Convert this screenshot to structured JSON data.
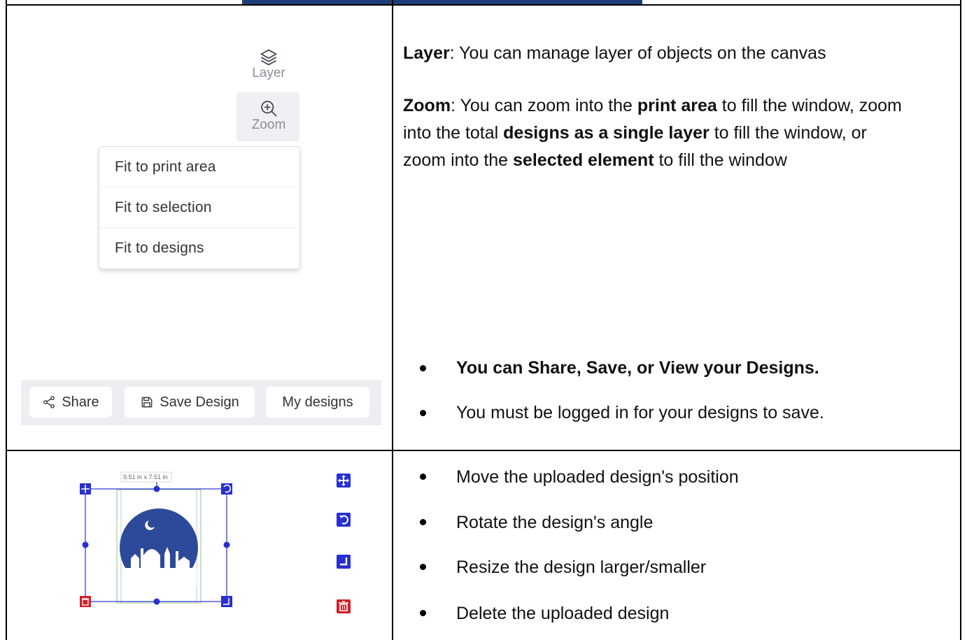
{
  "toolbar": {
    "layer_label": "Layer",
    "zoom_label": "Zoom"
  },
  "zoom_menu": {
    "items": [
      "Fit to print area",
      "Fit to selection",
      "Fit to designs"
    ]
  },
  "actions": {
    "share_label": "Share",
    "save_label": "Save Design",
    "my_designs_label": "My designs"
  },
  "row1": {
    "layer_term": "Layer",
    "layer_text": ": You can manage layer of objects on the canvas",
    "zoom_term": "Zoom",
    "zoom_text_1": ": You can zoom into the ",
    "zoom_bold_1": "print area",
    "zoom_text_2": " to fill the window, zoom into the total ",
    "zoom_bold_2": "designs as a single layer",
    "zoom_text_3": " to fill the window, or zoom into the ",
    "zoom_bold_3": "selected element",
    "zoom_text_4": " to fill the window",
    "bullet_bold": "You can Share, Save, or View your Designs.",
    "bullet_2": "You must be logged in for your designs to save."
  },
  "preview": {
    "dimensions": "9.51 in x 7.51 in"
  },
  "row2": {
    "bullets": [
      "Move the uploaded design's position",
      "Rotate the design's angle",
      "Resize the design larger/smaller",
      "Delete the uploaded design"
    ]
  },
  "colors": {
    "header_bar": "#1f3f7a",
    "handle_blue": "#2a2fd1",
    "handle_red": "#d0202a",
    "artwork_blue": "#2d4a9a"
  }
}
